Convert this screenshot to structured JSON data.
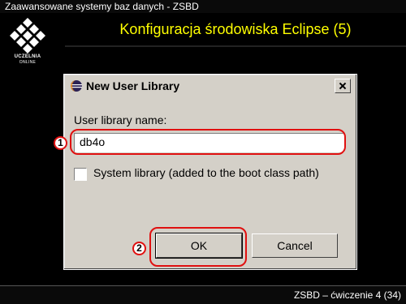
{
  "header": {
    "course_title": "Zaawansowane systemy baz danych - ZSBD",
    "slide_title": "Konfiguracja środowiska Eclipse (5)"
  },
  "logo": {
    "caption": "UCZELNIA",
    "caption_sub": "ONLINE",
    "icon": "grid-diamond-logo"
  },
  "dialog": {
    "title": "New User Library",
    "title_icon": "eclipse-icon",
    "close_icon": "close-icon",
    "library_name_label": "User library name:",
    "library_name_value": "db4o",
    "system_library_label": "System library (added to the boot class path)",
    "system_library_checked": false,
    "ok_label": "OK",
    "cancel_label": "Cancel"
  },
  "annotations": {
    "step1": "1",
    "step2": "2",
    "highlight_color": "#e01010"
  },
  "footer": {
    "text": "ZSBD – ćwiczenie 4 (34)"
  },
  "colors": {
    "slide_title": "#ffff00",
    "background": "#000000",
    "dialog_face": "#d4d0c8"
  }
}
